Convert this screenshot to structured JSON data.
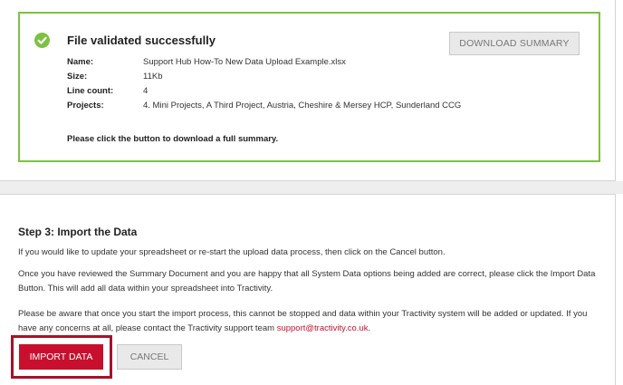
{
  "validation": {
    "title": "File validated successfully",
    "download_button": "DOWNLOAD SUMMARY",
    "details": [
      {
        "label": "Name:",
        "value": "Support Hub How-To New Data Upload Example.xlsx"
      },
      {
        "label": "Size:",
        "value": "11Kb"
      },
      {
        "label": "Line count:",
        "value": "4"
      },
      {
        "label": "Projects:",
        "value": "4. Mini Projects, A Third Project, Austria, Cheshire & Mersey HCP, Sunderland CCG"
      }
    ],
    "note": "Please click the button to download a full summary."
  },
  "import": {
    "title": "Step 3: Import the Data",
    "para1": "If you would like to update your spreadsheet or re-start the upload data process, then click on the Cancel button.",
    "para2": "Once you have reviewed the Summary Document and you are happy that all System Data options being added are correct, please click the Import Data Button. This will add all data within your spreadsheet into Tractivity.",
    "para3": "Please be aware that once you start the import process, this cannot be stopped and data within your Tractivity system will be added or updated. If you have any concerns at all, please contact the Tractivity support team ",
    "support_email": "support@tractivity.co.uk",
    "para3_end": ".",
    "import_button": "IMPORT DATA",
    "cancel_button": "CANCEL"
  },
  "colors": {
    "success_green": "#7cc242",
    "brand_red": "#c8102e",
    "highlight_border": "#a8102a"
  },
  "icons": {
    "status": "check-circle-icon"
  }
}
